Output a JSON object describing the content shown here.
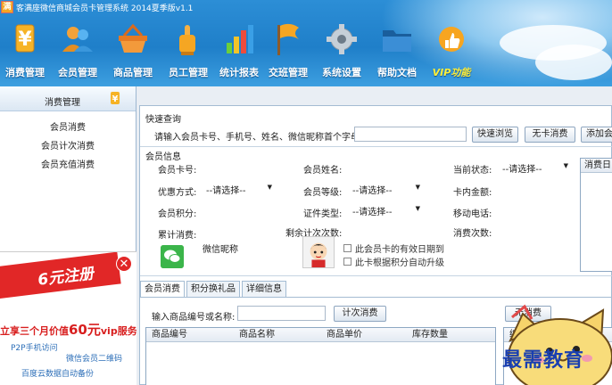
{
  "app": {
    "logo_char": "满",
    "title": "客满座微信商城会员卡管理系统 2014夏季版v1.1"
  },
  "nav": [
    {
      "label": "消费管理",
      "icon": "yuan-icon"
    },
    {
      "label": "会员管理",
      "icon": "members-icon"
    },
    {
      "label": "商品管理",
      "icon": "basket-icon"
    },
    {
      "label": "员工管理",
      "icon": "staff-icon"
    },
    {
      "label": "统计报表",
      "icon": "bar-chart-icon"
    },
    {
      "label": "交班管理",
      "icon": "flag-icon"
    },
    {
      "label": "系统设置",
      "icon": "gear-icon"
    },
    {
      "label": "帮助文档",
      "icon": "folder-icon"
    },
    {
      "label": "VIP功能",
      "icon": "vip-like-icon"
    }
  ],
  "sidebar": {
    "title": "消费管理",
    "items": [
      "会员消费",
      "会员计次消费",
      "会员充值消费"
    ]
  },
  "ad": {
    "banner": "6元注册",
    "promo_prefix": "立享三个月价值",
    "promo_amount": "60元",
    "promo_suffix": "vip服务",
    "links": [
      "P2P手机访问",
      "微信会员二维码",
      "百度云数据自动备份"
    ]
  },
  "quick_search": {
    "title": "快速查询",
    "prompt": "请输入会员卡号、手机号、姓名、微信昵称首个字母",
    "value": "",
    "browse_button": "快速浏览",
    "no_card_button": "无卡消费",
    "add_button": "添加会"
  },
  "member_info": {
    "title": "会员信息",
    "card_no_label": "会员卡号:",
    "name_label": "会员姓名:",
    "status_label": "当前状态:",
    "status_value": "--请选择--",
    "discount_label": "优惠方式:",
    "discount_value": "--请选择--",
    "level_label": "会员等级:",
    "level_value": "--请选择--",
    "balance_label": "卡内金额:",
    "points_label": "会员积分:",
    "id_type_label": "证件类型:",
    "id_type_value": "--请选择--",
    "phone_label": "移动电话:",
    "total_label": "累计消费:",
    "remaining_label": "剩余计次次数:",
    "visits_label": "消费次数:",
    "wechat_label": "微信昵称",
    "check_expiry": "此会员卡的有效日期到",
    "check_upgrade": "此卡根据积分自动升级",
    "history_header": "消费日"
  },
  "tabs": [
    "会员消费",
    "积分换礼品",
    "详细信息"
  ],
  "consume": {
    "input_label": "输入商品编号或名称:",
    "input_value": "",
    "count_button": "计次消费",
    "columns": [
      "商品编号",
      "商品名称",
      "商品单价",
      "库存数量"
    ],
    "right_button": "无消费",
    "right_column": "编号"
  },
  "watermark": "最需教育"
}
